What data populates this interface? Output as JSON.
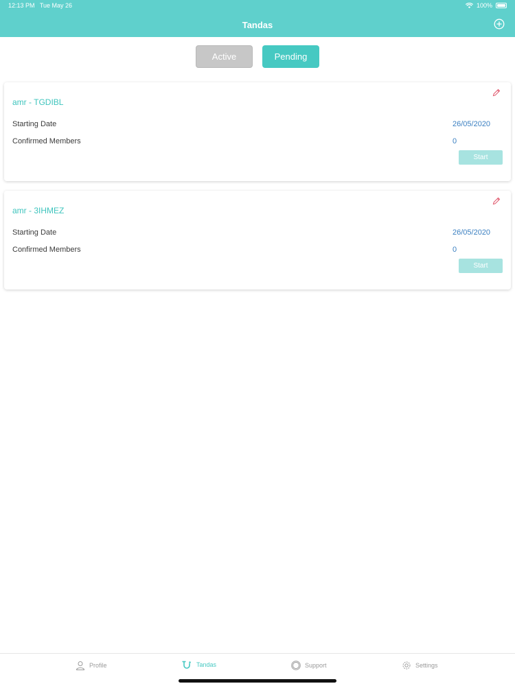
{
  "status_bar": {
    "time": "12:13 PM",
    "date": "Tue May 26",
    "battery": "100%"
  },
  "nav": {
    "title": "Tandas",
    "add_icon": "plus-circle-icon"
  },
  "segments": {
    "active": "Active",
    "pending": "Pending",
    "selected": "Pending"
  },
  "cards": [
    {
      "title": "amr - TGDIBL",
      "start_label": "Starting Date",
      "start_value": "26/05/2020",
      "members_label": "Confirmed Members",
      "members_value": "0",
      "button": "Start"
    },
    {
      "title": "amr - 3IHMEZ",
      "start_label": "Starting Date",
      "start_value": "26/05/2020",
      "members_label": "Confirmed Members",
      "members_value": "0",
      "button": "Start"
    }
  ],
  "tabs": [
    {
      "label": "Profile",
      "icon": "person-icon"
    },
    {
      "label": "Tandas",
      "icon": "tandas-icon"
    },
    {
      "label": "Support",
      "icon": "lifebuoy-icon"
    },
    {
      "label": "Settings",
      "icon": "gear-icon"
    }
  ],
  "colors": {
    "accent": "#46c9c2",
    "header": "#5fd0cc",
    "date_blue": "#3a7fc1",
    "edit_red": "#e0556a"
  }
}
